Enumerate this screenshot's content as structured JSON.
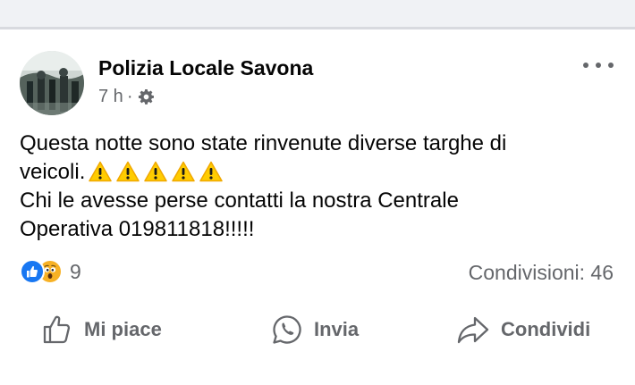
{
  "post": {
    "author": "Polizia Locale Savona",
    "time": "7 h",
    "separator": "·",
    "audience_icon": "gear-icon",
    "text_line1": "Questa notte sono state rinvenute diverse targhe di",
    "text_line2": "veicoli.",
    "text_line2_emoji": [
      "⚠️",
      "⚠️",
      "⚠️",
      "⚠️",
      "⚠️"
    ],
    "text_line3": "Chi le avesse perse contatti la nostra Centrale",
    "text_line4": "Operativa 019811818!!!!!"
  },
  "reactions": {
    "icons": [
      "like-icon",
      "wow-icon"
    ],
    "count": "9",
    "shares": "Condivisioni: 46"
  },
  "actions": {
    "like": "Mi piace",
    "send": "Invia",
    "share": "Condividi"
  },
  "colors": {
    "text": "#050505",
    "secondary": "#65676b",
    "like_blue": "#1877f2",
    "wow_yellow": "#f7b125",
    "warning_yellow": "#ffcc00"
  }
}
